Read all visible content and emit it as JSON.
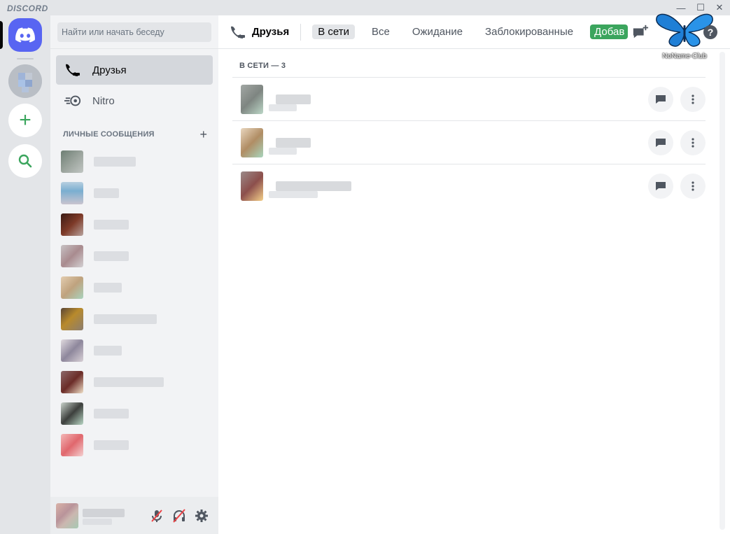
{
  "window": {
    "brand": "DISCORD",
    "minimize_glyph": "—",
    "maximize_glyph": "☐",
    "close_glyph": "✕"
  },
  "guilds": {
    "home_icon": "discord-logo-icon",
    "add_glyph": "+",
    "explore_icon": "search-icon"
  },
  "sidebar": {
    "search_placeholder": "Найти или начать беседу",
    "nav": {
      "friends": "Друзья",
      "nitro": "Nitro"
    },
    "dm_header": "ЛИЧНЫЕ СООБЩЕНИЯ",
    "dm_add_glyph": "+",
    "dm_count": 10
  },
  "topbar": {
    "title": "Друзья",
    "tabs": {
      "online": "В сети",
      "all": "Все",
      "pending": "Ожидание",
      "blocked": "Заблокированные",
      "add_friend": "Добав"
    },
    "help_glyph": "?",
    "watermark": "NoName-Club"
  },
  "main": {
    "section_title": "В СЕТИ — 3"
  },
  "colors": {
    "blurple": "#5865f2",
    "green": "#3ba55d",
    "watermark_blue": "#1f7fd6"
  }
}
